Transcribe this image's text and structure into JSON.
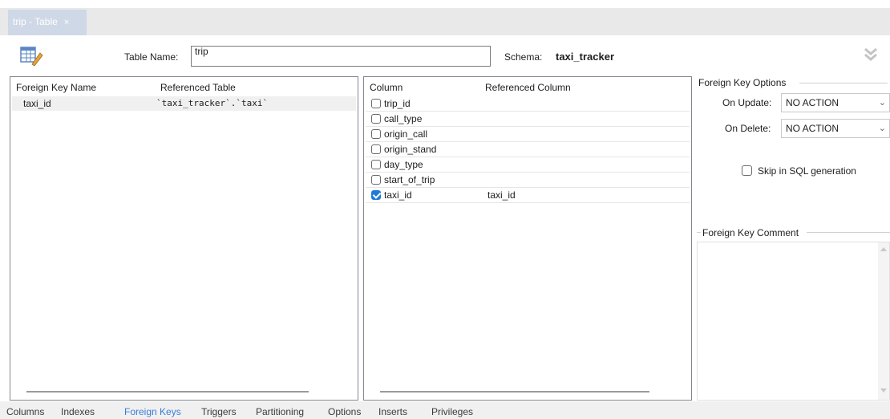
{
  "document_tab": {
    "label": "trip - Table",
    "close": "×"
  },
  "header": {
    "table_name_label": "Table Name:",
    "table_name_value": "trip",
    "schema_label": "Schema:",
    "schema_value": "taxi_tracker"
  },
  "fk_list": {
    "col_name": "Foreign Key Name",
    "col_ref_table": "Referenced Table",
    "rows": [
      {
        "name": "taxi_id",
        "ref_table": "`taxi_tracker`.`taxi`"
      }
    ]
  },
  "column_map": {
    "col_column": "Column",
    "col_ref_column": "Referenced Column",
    "rows": [
      {
        "column": "trip_id",
        "checked": false,
        "ref": ""
      },
      {
        "column": "call_type",
        "checked": false,
        "ref": ""
      },
      {
        "column": "origin_call",
        "checked": false,
        "ref": ""
      },
      {
        "column": "origin_stand",
        "checked": false,
        "ref": ""
      },
      {
        "column": "day_type",
        "checked": false,
        "ref": ""
      },
      {
        "column": "start_of_trip",
        "checked": false,
        "ref": ""
      },
      {
        "column": "taxi_id",
        "checked": true,
        "ref": "taxi_id"
      }
    ]
  },
  "fk_options": {
    "title": "Foreign Key Options",
    "on_update_label": "On Update:",
    "on_update_value": "NO ACTION",
    "on_delete_label": "On Delete:",
    "on_delete_value": "NO ACTION",
    "skip_sql_label": "Skip in SQL generation",
    "skip_sql_checked": false,
    "comment_title": "Foreign Key Comment"
  },
  "bottom_tabs": [
    {
      "label": "Columns",
      "active": false
    },
    {
      "label": "Indexes",
      "active": false
    },
    {
      "label": "Foreign Keys",
      "active": true
    },
    {
      "label": "Triggers",
      "active": false
    },
    {
      "label": "Partitioning",
      "active": false
    },
    {
      "label": "Options",
      "active": false
    },
    {
      "label": "Inserts",
      "active": false
    },
    {
      "label": "Privileges",
      "active": false
    }
  ],
  "colors": {
    "accent": "#1f7ad6",
    "active_tab_text": "#3a7dd8",
    "doc_tab_bg": "#cfd8e6"
  },
  "icons": {
    "table_icon": "table-edit-icon",
    "collapse": "double-chevron-down-icon"
  }
}
